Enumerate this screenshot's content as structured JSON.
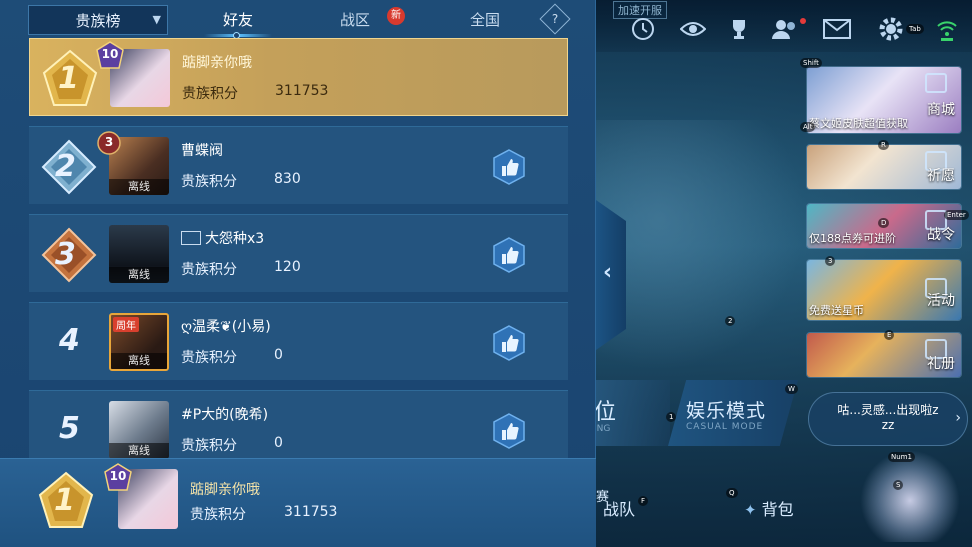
{
  "tabs": {
    "dropdown": "贵族榜",
    "items": [
      "好友",
      "战区",
      "全国"
    ],
    "new_badge": "新",
    "help": "?"
  },
  "score_label": "贵族积分",
  "rows": [
    {
      "rank": "1",
      "level": "10",
      "name": "踮脚亲你哦",
      "score": "311753",
      "offline": ""
    },
    {
      "rank": "2",
      "level": "3",
      "name": "曹蝶阀",
      "score": "830",
      "offline": "离线"
    },
    {
      "rank": "3",
      "level": "",
      "name": "大怨种x3",
      "score": "120",
      "offline": "离线"
    },
    {
      "rank": "4",
      "level": "",
      "name": "ღ温柔❦(小易)",
      "score": "0",
      "offline": "离线",
      "avatar_tag": "周年"
    },
    {
      "rank": "5",
      "level": "",
      "name": "#P大的(晚希)",
      "score": "0",
      "offline": "离线"
    }
  ],
  "self": {
    "rank": "1",
    "level": "10",
    "name": "踮脚亲你哦",
    "score": "311753"
  },
  "game": {
    "speedup": "加速开服",
    "promos": [
      {
        "caption": "蔡文姬皮肤超值获取",
        "label": "商城"
      },
      {
        "caption": "",
        "label": "祈愿"
      },
      {
        "caption": "仅188点券可进阶",
        "label": "战令"
      },
      {
        "caption": "免费送星币",
        "label": "活动"
      },
      {
        "caption": "",
        "label": "礼册"
      }
    ],
    "mode_rank_title": "位",
    "mode_rank_sub": "ING",
    "mode_casual_title": "娱乐模式",
    "mode_casual_sub": "CASUAL MODE",
    "bubble_line1": "咕...灵感...出现啦z",
    "bubble_line2": "zz",
    "bottom_left": "赛",
    "bottom_team": "战队",
    "bottom_bag": "背包",
    "keyhints": [
      "Shift",
      "Tab",
      "Alt",
      "R",
      "D",
      "Enter",
      "3",
      "2",
      "E",
      "W",
      "1",
      "Num1",
      "S",
      "B",
      "C",
      "F",
      "Q",
      "X"
    ]
  }
}
